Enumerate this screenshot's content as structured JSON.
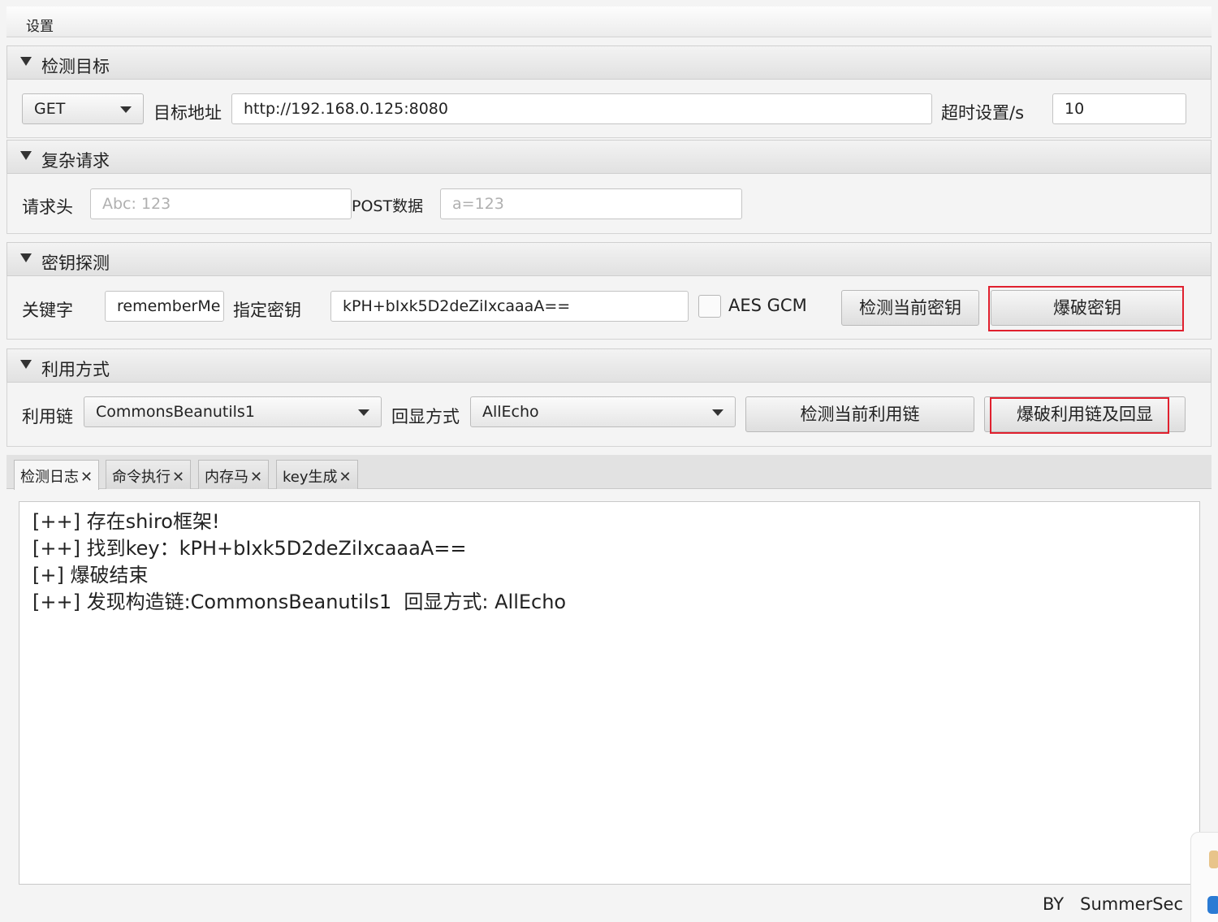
{
  "menu": {
    "settings": "设置"
  },
  "target": {
    "header": "检测目标",
    "method": "GET",
    "url_label": "目标地址",
    "url": "http://192.168.0.125:8080",
    "timeout_label": "超时设置/s",
    "timeout": "10"
  },
  "complex": {
    "header": "复杂请求",
    "headers_label": "请求头",
    "headers_placeholder": "Abc: 123",
    "post_label": "POST数据",
    "post_placeholder": "a=123"
  },
  "key": {
    "header": "密钥探测",
    "keyword_label": "关键字",
    "keyword": "rememberMe",
    "specified_label": "指定密钥",
    "specified": "kPH+bIxk5D2deZiIxcaaaA==",
    "aes_gcm_label": "AES GCM",
    "aes_gcm_checked": false,
    "detect_button": "检测当前密钥",
    "brute_button": "爆破密钥"
  },
  "exploit": {
    "header": "利用方式",
    "chain_label": "利用链",
    "chain": "CommonsBeanutils1",
    "echo_label": "回显方式",
    "echo": "AllEcho",
    "detect_button": "检测当前利用链",
    "brute_button": "爆破利用链及回显"
  },
  "tabs": [
    {
      "label": "检测日志",
      "active": true
    },
    {
      "label": "命令执行",
      "active": false
    },
    {
      "label": "内存马",
      "active": false
    },
    {
      "label": "key生成",
      "active": false
    }
  ],
  "log_lines": [
    "[++] 存在shiro框架!",
    "[++] 找到key：kPH+bIxk5D2deZiIxcaaaA==",
    "[+] 爆破结束",
    "[++] 发现构造链:CommonsBeanutils1  回显方式: AllEcho"
  ],
  "footer": "BY   SummerSec",
  "colors": {
    "highlight": "#e0202e"
  }
}
